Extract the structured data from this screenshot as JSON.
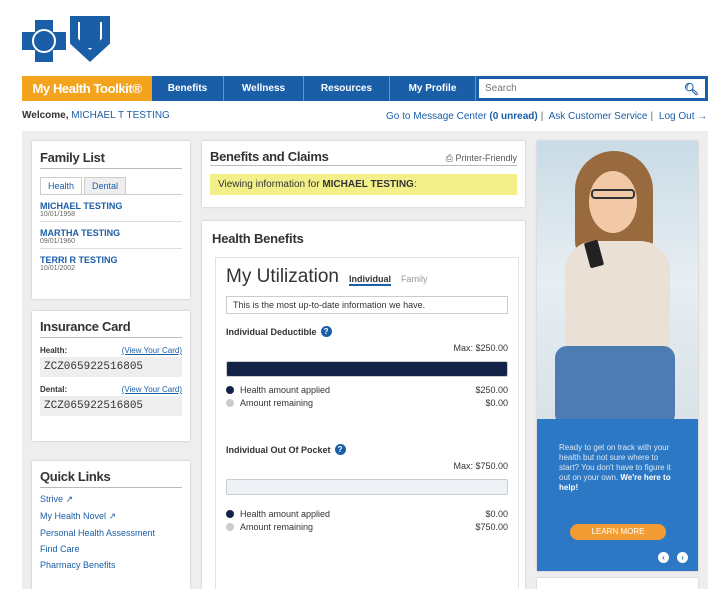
{
  "nav": {
    "brand": "My Health Toolkit®",
    "items": [
      "Benefits",
      "Wellness",
      "Resources",
      "My Profile"
    ],
    "search_placeholder": "Search"
  },
  "welcome": {
    "prefix": "Welcome,",
    "name": "MICHAEL T TESTING"
  },
  "toplinks": {
    "message_center": "Go to Message Center",
    "unread": "(0 unread)",
    "ask": "Ask Customer Service",
    "logout": "Log Out"
  },
  "family": {
    "title": "Family List",
    "tabs": [
      "Health",
      "Dental"
    ],
    "members": [
      {
        "name": "MICHAEL TESTING",
        "dob": "10/01/1958"
      },
      {
        "name": "MARTHA TESTING",
        "dob": "09/01/1960"
      },
      {
        "name": "TERRI R TESTING",
        "dob": "10/01/2002"
      }
    ]
  },
  "insurance": {
    "title": "Insurance Card",
    "health_label": "Health:",
    "dental_label": "Dental:",
    "view_link": "(View Your Card)",
    "health_number": "ZCZ065922516805",
    "dental_number": "ZCZ065922516805"
  },
  "quick_links": {
    "title": "Quick Links",
    "items": [
      "Strive",
      "My Health Novel",
      "Personal Health Assessment",
      "Find Care",
      "Pharmacy Benefits"
    ]
  },
  "benefits": {
    "title": "Benefits and Claims",
    "printer": "Printer-Friendly",
    "viewing_prefix": "Viewing information for",
    "viewing_name": "MICHAEL TESTING",
    "viewing_suffix": ":"
  },
  "health": {
    "title": "Health Benefits",
    "util_title": "My Utilization",
    "tabs": [
      "Individual",
      "Family"
    ],
    "uptodate": "This is the most up-to-date information we have.",
    "deductible": {
      "label": "Individual Deductible",
      "max": "Max: $250.00",
      "applied_label": "Health amount applied",
      "applied": "$250.00",
      "remaining_label": "Amount remaining",
      "remaining": "$0.00",
      "fill_fraction": 1.0
    },
    "oop": {
      "label": "Individual Out Of Pocket",
      "max": "Max: $750.00",
      "applied_label": "Health amount applied",
      "applied": "$0.00",
      "remaining_label": "Amount remaining",
      "remaining": "$750.00",
      "fill_fraction": 0.0
    },
    "colors": {
      "applied": "#14224a",
      "remaining": "#cccccc"
    }
  },
  "ad": {
    "text_1": "Ready to get on track with your health but not sure where to start? You don't have to figure it out on your own.",
    "text_bold": "We're here to help!",
    "button": "LEARN MORE"
  }
}
